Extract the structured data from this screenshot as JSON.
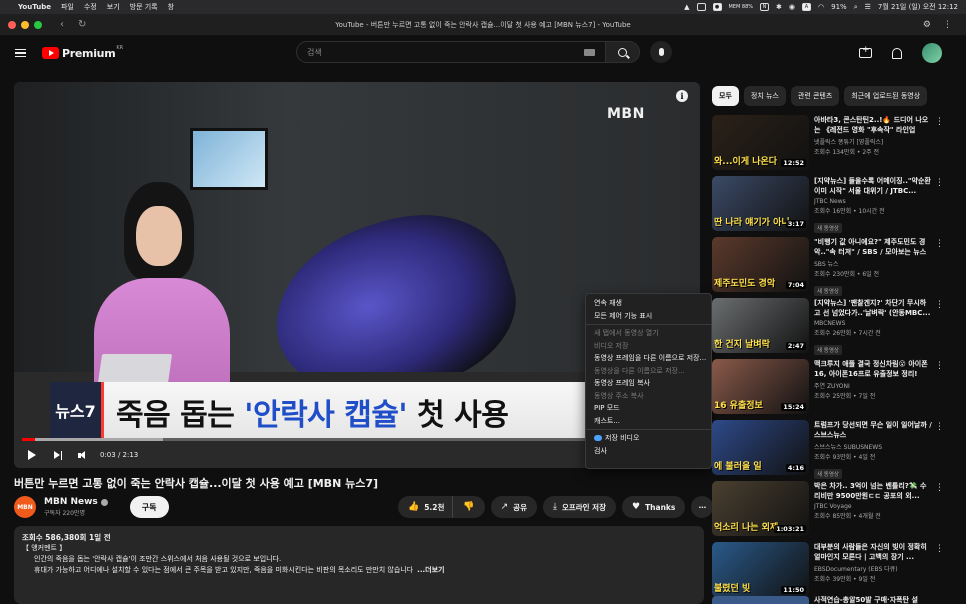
{
  "menubar": {
    "app_name": "YouTube",
    "items": [
      "파일",
      "수정",
      "보기",
      "방문 기록",
      "창"
    ],
    "tray_labels": [
      "MEM 88%",
      "91%"
    ],
    "battery": "91%",
    "clock": "7월 21일 (일) 오전 12:12"
  },
  "window": {
    "title": "YouTube - 버튼만 누르면 고통 없이 죽는 안락사 캡슐...이달 첫 사용 예고 [MBN 뉴스7] - YouTube"
  },
  "header": {
    "logo_text": "Premium",
    "logo_region": "KR",
    "search_placeholder": "검색"
  },
  "player": {
    "watermark": "MBN",
    "lower_third_tag": "뉴스7",
    "lower_third_pre": "죽음 돕는 ",
    "lower_third_highlight": "'안락사 캡슐'",
    "lower_third_post": " 첫 사용 ",
    "time": "0:03 / 2:13",
    "progress": 0.02,
    "buffered": 0.21
  },
  "context_menu": {
    "items": [
      {
        "label": "연속 재생",
        "enabled": true
      },
      {
        "label": "모든 제어 기능 표시",
        "enabled": true
      },
      {
        "label": "새 탭에서 동영상 열기",
        "enabled": false
      },
      {
        "label": "비디오 저장",
        "enabled": false
      },
      {
        "label": "동영상 프레임을 다른 이름으로 저장...",
        "enabled": true
      },
      {
        "label": "동영상을 다른 이름으로 저장...",
        "enabled": false
      },
      {
        "label": "동영상 프레임 복사",
        "enabled": true
      },
      {
        "label": "동영상 주소 복사",
        "enabled": false
      },
      {
        "label": "PIP 모드",
        "enabled": true
      },
      {
        "label": "캐스트...",
        "enabled": true
      },
      {
        "label": "저장 비디오",
        "enabled": true
      },
      {
        "label": "검사",
        "enabled": true
      }
    ]
  },
  "video": {
    "title": "버튼만 누르면 고통 없이 죽는 안락사 캡슐...이달 첫 사용 예고 [MBN 뉴스7]",
    "channel": "MBN News",
    "subscribers": "구독자 220만명",
    "subscribe_label": "구독",
    "likes": "5.2천",
    "share_label": "공유",
    "offline_label": "오프라인 저장",
    "thanks_label": "Thanks",
    "avatar_text": "MBN"
  },
  "description": {
    "stats": "조회수 586,380회  1일 전",
    "line1": "【 앵커멘트 】",
    "line2": "인간의 죽음을 돕는 '안락사 캡슐'이 조만간 스위스에서 처음 사용될 것으로 보입니다.",
    "line3": "휴대가 가능하고 어디에나 설치할 수 있다는 점에서 큰 주목을 받고 있지만, 죽음을 미화시킨다는 비판의 목소리도 만만치 않습니다",
    "more": "...더보기"
  },
  "chips": [
    "모두",
    "정치 뉴스",
    "관련 콘텐츠",
    "최근에 업로드된 동영상"
  ],
  "recommendations": [
    {
      "title": "아바타3, 콘스탄틴2..!🔥 드디어 나오는 《레전드 영화 \"후속작\" 라인업 총...",
      "channel": "넷플릭스 똥튜기 [영플릭스]",
      "stats": "조회수 134만회 • 2주 전",
      "duration": "12:52",
      "caption": "와...이게 나온다",
      "badge": "",
      "thumb": "#2b2118"
    },
    {
      "title": "[지약뉴스] 들을수록 어메이징..\"약순환 이미 시작\" 서울 대위기 / JTBC...",
      "channel": "JTBC News",
      "stats": "조회수 16만회 • 10시간 전",
      "duration": "3:17",
      "caption": "딴 나라 얘기가 아니",
      "badge": "새 동영상",
      "thumb": "#3b4a66"
    },
    {
      "title": "\"비행기 값 아니에요?\" 제주도민도 경악..\"속 터져\" / SBS / 모아보는 뉴스",
      "channel": "SBS 뉴스",
      "stats": "조회수 230만회 • 6일 전",
      "duration": "7:04",
      "caption": "제주도민도 경악",
      "badge": "새 동영상",
      "thumb": "#5b3a2c"
    },
    {
      "title": "[지약뉴스] '팬찰겐지?' 차단기 무시하고 선 넘었다가..'날벼락' (안동MBC...",
      "channel": "MBCNEWS",
      "stats": "조회수 26만회 • 7시간 전",
      "duration": "2:47",
      "caption": "한 건지 날벼락",
      "badge": "새 동영상",
      "thumb": "#6b6e70"
    },
    {
      "title": "맥크루지 애플 결국 정신차림😮 아이폰16, 아이폰16프로 유출정보 정리!",
      "channel": "주연 ZUYONI",
      "stats": "조회수 25만회 • 7일 전",
      "duration": "15:24",
      "caption": "16 유출정보",
      "badge": "",
      "thumb": "#8a5a4a"
    },
    {
      "title": "트럼프가 당선되면 무슨 일이 일어날까 / 스브스뉴스",
      "channel": "스브스뉴스 SUBUSNEWS",
      "stats": "조회수 93만회 • 4일 전",
      "duration": "4:16",
      "caption": "에 불러올 일",
      "badge": "새 동영상",
      "thumb": "#2e4a8a"
    },
    {
      "title": "박은 차가.. 3억이 넘는 벤틀리?💸 수리비만 9500만원ㄷㄷ 공포의 외...",
      "channel": "JTBC Voyage",
      "stats": "조회수 85만회 • 4개월 전",
      "duration": "1:03:21",
      "caption": "억소리 나는 외제",
      "badge": "",
      "thumb": "#4a4030"
    },
    {
      "title": "대부분의 사람들은 자신의 빚이 정확히 얼마인지 모른다 | 고백의 장기 ...",
      "channel": "EBSDocumentary (EBS 다큐)",
      "stats": "조회수 39만회 • 9일 전",
      "duration": "11:50",
      "caption": "불렸던 빚",
      "badge": "",
      "thumb": "#2a5a8a"
    }
  ],
  "last_rec_title": "사적연습-총알50발 구매·자폭탄 설"
}
